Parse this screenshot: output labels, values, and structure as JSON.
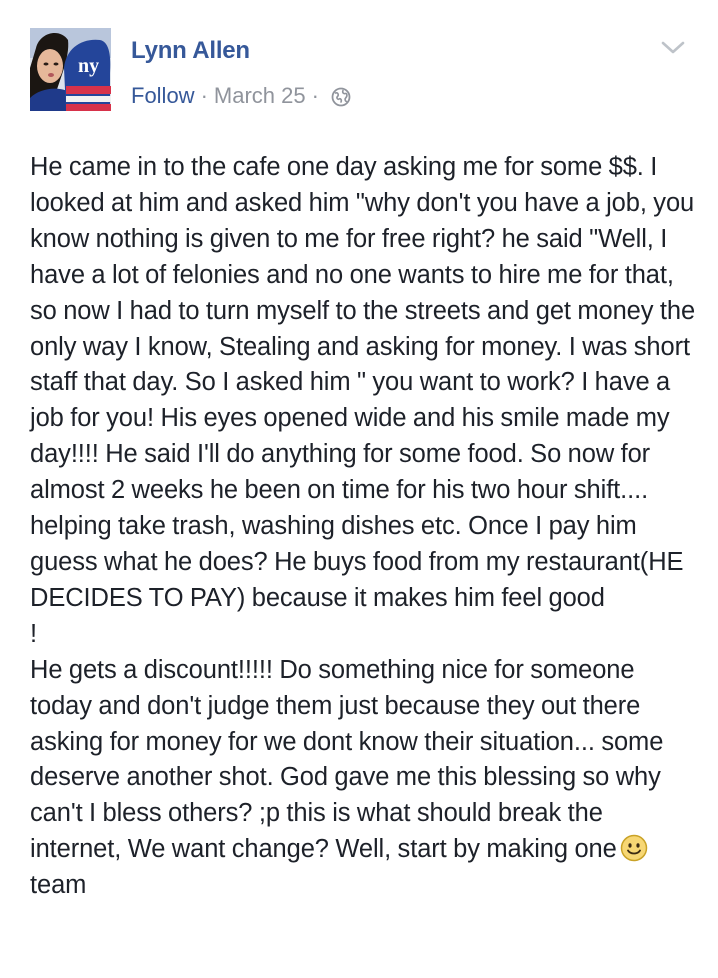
{
  "post": {
    "author": "Lynn Allen",
    "follow_label": "Follow",
    "separator": "·",
    "date": "March 25",
    "privacy_icon": "globe-icon",
    "menu_icon": "chevron-down-icon",
    "body_text": "He came in to the cafe one day asking me for some $$. I looked at him and asked him \"why don't you have a job, you know nothing is given to me for free right? he said \"Well, I have a lot of felonies and no one wants to hire me for that, so now I had to turn myself to the streets and get money the only way I know, Stealing and asking for money. I was short staff that day. So I asked him \" you want to work? I have a job for you! His eyes opened wide and his smile made my day!!!! He said I'll do anything for some food. So now for almost 2 weeks he been on time for his two hour shift.... helping take trash, washing dishes etc. Once I pay him guess what he does? He buys food from my restaurant(HE DECIDES TO PAY) because it makes him feel good\n!\nHe gets a discount!!!!! Do something nice for someone today and don't judge them just because they out there asking for money for we dont know their situation... some deserve another shot. God gave me this blessing so why can't I bless others? ;p this is what should break the internet, We want change? Well, start by making one",
    "emoji_icon": "smiley-emoji-icon",
    "body_tail": "team"
  },
  "colors": {
    "link": "#365899",
    "meta": "#90949c",
    "text": "#1d2129",
    "background": "#ffffff"
  }
}
